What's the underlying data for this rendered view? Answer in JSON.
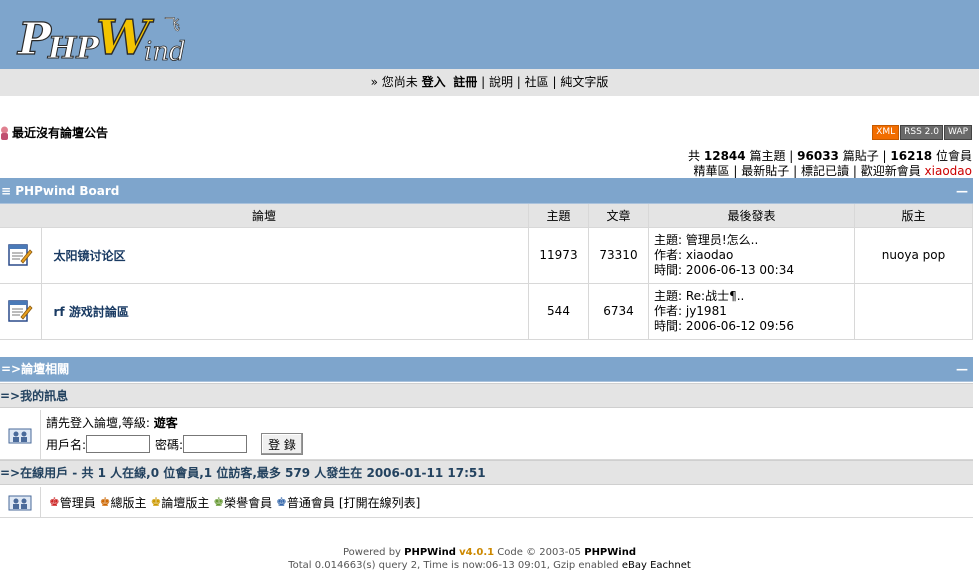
{
  "header": {
    "logo_text": "PHPWind"
  },
  "topnav": {
    "prefix": "» 您尚未",
    "login": "登入",
    "register": "註冊",
    "help": "說明",
    "community": "社區",
    "text_version": "純文字版",
    "sep": "|"
  },
  "notice": {
    "text": "最近沒有論壇公告"
  },
  "badges": {
    "xml": "XML",
    "rss": "RSS 2.0",
    "wap": "WAP"
  },
  "stats": {
    "t1": "共",
    "threads": "12844",
    "t2": "篇主題 |",
    "posts": "96033",
    "t3": "篇貼子 |",
    "members": "16218",
    "t4": "位會員"
  },
  "links": {
    "essence": "精華區",
    "latest": "最新貼子",
    "mark_read": "標記已讀",
    "welcome": "歡迎新會員",
    "new_member": "xiaodao",
    "sep": "|"
  },
  "board": {
    "title": "≡ PHPwind Board",
    "min": "—",
    "columns": {
      "forum": "論壇",
      "topics": "主題",
      "posts": "文章",
      "last": "最後發表",
      "moderator": "版主"
    },
    "forums": [
      {
        "name": "太阳镜讨论区",
        "topics": "11973",
        "posts": "73310",
        "last_subject": "主題: 管理员!怎么..",
        "last_author": "作者: xiaodao",
        "last_time": "時間: 2006-06-13 00:34",
        "moderator": "nuoya pop"
      },
      {
        "name": "rf 游戏討論區",
        "topics": "544",
        "posts": "6734",
        "last_subject": "主題: Re:战士¶..",
        "last_author": "作者: jy1981",
        "last_time": "時間: 2006-06-12 09:56",
        "moderator": ""
      }
    ]
  },
  "related": {
    "title": "=>論壇相關",
    "min": "—",
    "my_info": "=>我的訊息",
    "login_prompt": "請先登入論壇,等級:",
    "level": "遊客",
    "user_label": "用戶名:",
    "pass_label": "密碼:",
    "login_button": "登 錄",
    "online_title": "=>在線用戶 - 共 1 人在線,0 位會員,1 位訪客,最多 579 人發生在 2006-01-11 17:51",
    "legend_admin": "管理員",
    "legend_super": "總版主",
    "legend_mod": "論壇版主",
    "legend_honor": "榮譽會員",
    "legend_normal": "普通會員",
    "open_list": "[打開在線列表]"
  },
  "footer": {
    "powered": "Powered by",
    "brand": "PHPWind",
    "version": "v4.0.1",
    "code": "Code © 2003-05",
    "brand2": "PHPWind",
    "line2": "Total 0.014663(s) query 2, Time is now:06-13 09:01, Gzip enabled",
    "ebay": "eBay Eachnet"
  },
  "colors": {
    "header_bg": "#7ea5cc",
    "nav_bg": "#e4e4e4",
    "title_bar": "#7ea5cc",
    "link_red": "#cc0000"
  }
}
